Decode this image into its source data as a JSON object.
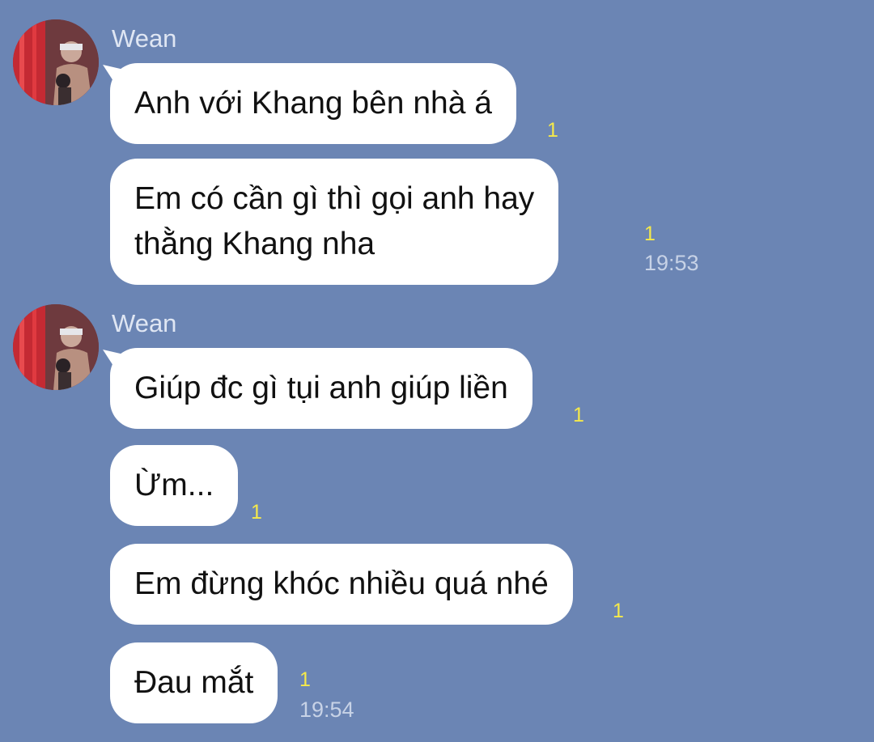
{
  "groups": [
    {
      "sender": "Wean",
      "avatar_icon": "profile-photo",
      "messages": [
        {
          "lines": [
            "Anh với Khang bên nhà á"
          ],
          "unread": "1",
          "time": ""
        },
        {
          "lines": [
            "Em có cần gì thì gọi anh hay",
            "thằng Khang nha"
          ],
          "unread": "1",
          "time": "19:53"
        }
      ]
    },
    {
      "sender": "Wean",
      "avatar_icon": "profile-photo",
      "messages": [
        {
          "lines": [
            "Giúp đc gì tụi anh giúp liền"
          ],
          "unread": "1",
          "time": ""
        },
        {
          "lines": [
            "Ừm..."
          ],
          "unread": "1",
          "time": ""
        },
        {
          "lines": [
            "Em đừng khóc nhiều quá nhé"
          ],
          "unread": "1",
          "time": ""
        },
        {
          "lines": [
            "Đau mắt"
          ],
          "unread": "1",
          "time": "19:54"
        }
      ]
    }
  ],
  "colors": {
    "background": "#6b85b4",
    "bubble": "#ffffff",
    "unread": "#f5e94a",
    "time": "#c7d2e6"
  }
}
